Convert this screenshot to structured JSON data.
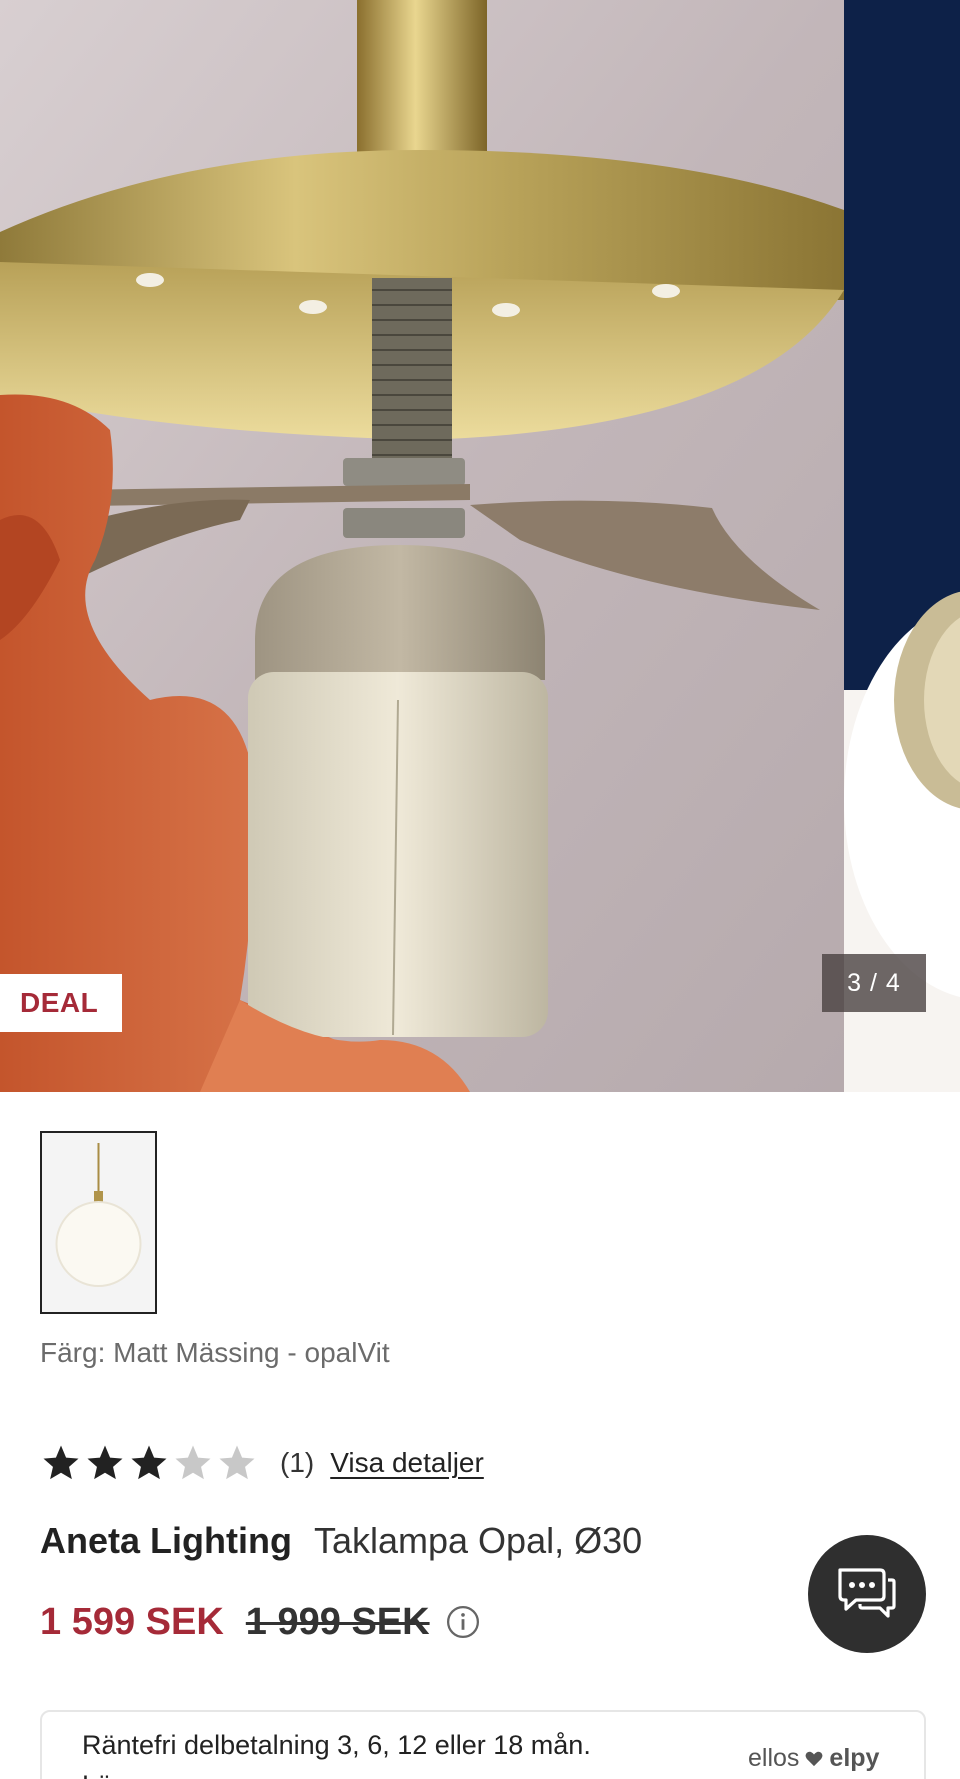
{
  "gallery": {
    "badge": "DEAL",
    "counter": "3 / 4"
  },
  "product": {
    "color_line": "Färg: Matt Mässing - opalVit",
    "rating": {
      "stars": 3,
      "max_stars": 5,
      "count": "(1)",
      "details_link": "Visa detaljer"
    },
    "brand": "Aneta Lighting",
    "name": "Taklampa Opal, Ø30",
    "price_now": "1 599 SEK",
    "price_old": "1 999 SEK"
  },
  "payment": {
    "text": "Räntefri delbetalning 3, 6, 12 eller 18 mån.",
    "more": "Lä...",
    "logo_left": "ellos",
    "logo_right": "elpy"
  },
  "colors": {
    "sale_red": "#a52a38",
    "chat_bg": "#2f2f2f",
    "star_filled": "#222222",
    "star_empty": "#c8c8c8",
    "navy_backdrop": "#0d2148"
  },
  "icons": {
    "info": "info-icon",
    "chat": "chat-icon",
    "star": "star-icon"
  }
}
